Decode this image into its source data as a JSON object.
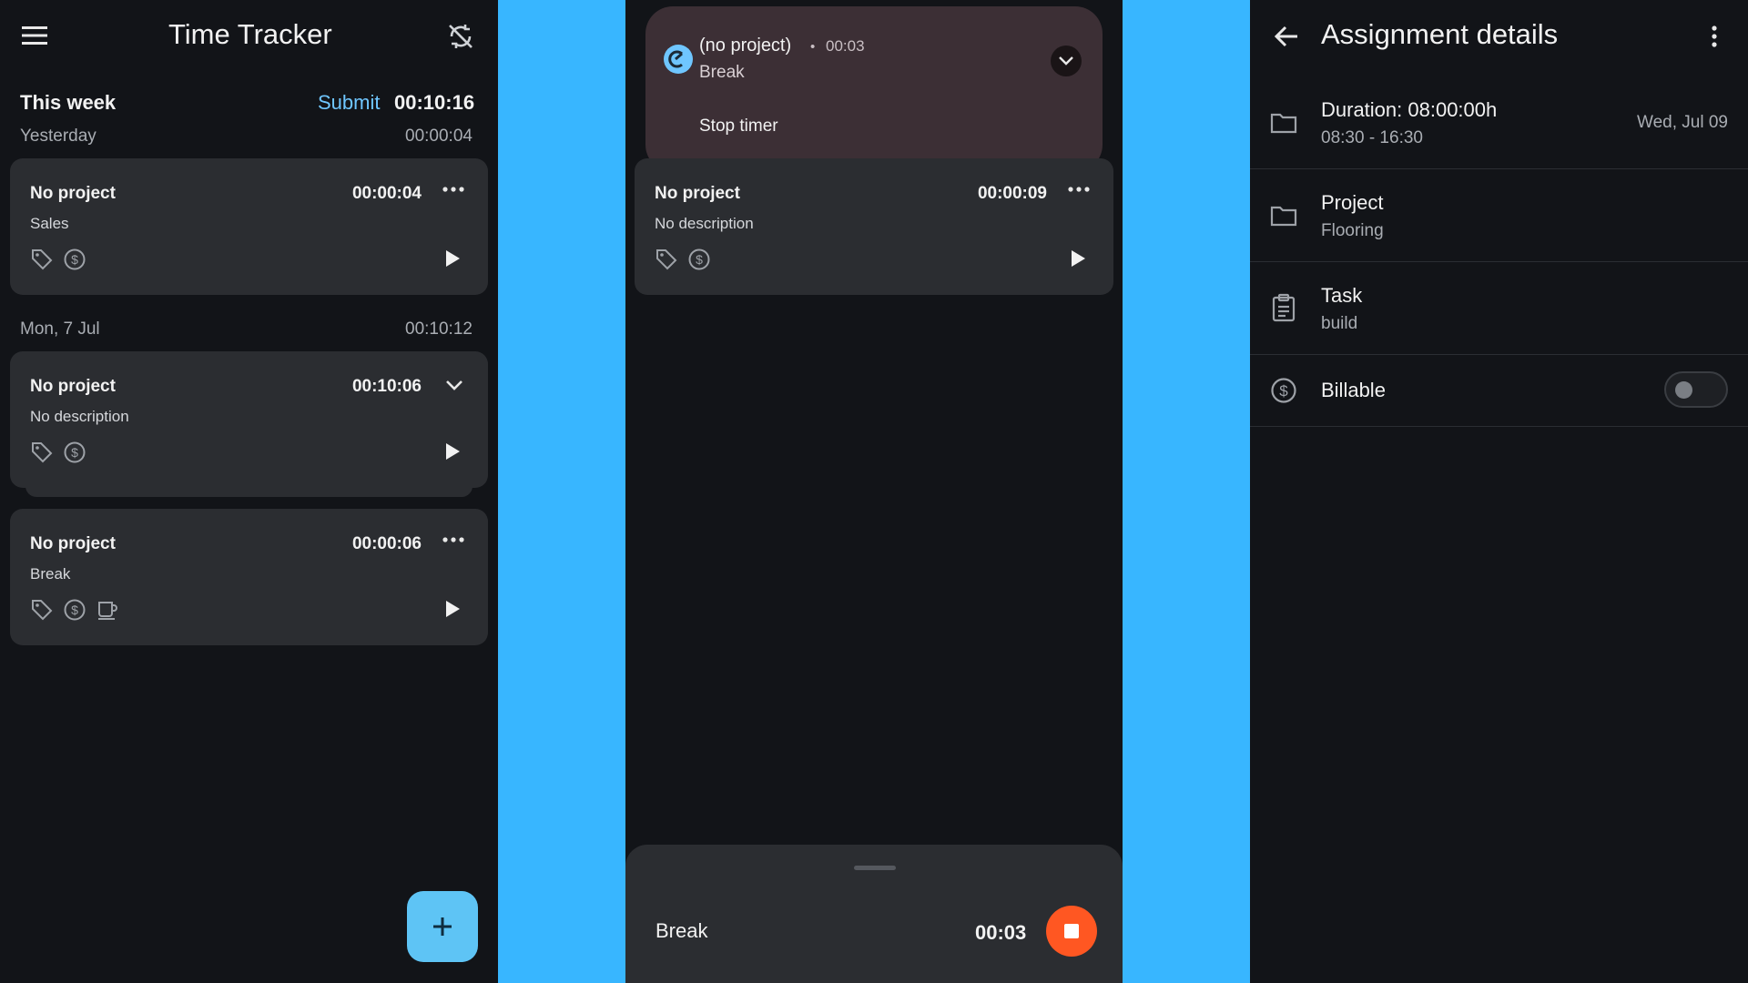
{
  "panel1": {
    "title": "Time Tracker",
    "week_label": "This week",
    "submit_label": "Submit",
    "week_total": "00:10:16",
    "groups": [
      {
        "day": "Yesterday",
        "total": "00:00:04",
        "entries": [
          {
            "project": "No project",
            "duration": "00:00:04",
            "description": "Sales"
          }
        ]
      },
      {
        "day": "Mon, 7 Jul",
        "total": "00:10:12",
        "entries": [
          {
            "project": "No project",
            "duration": "00:10:06",
            "description": "No description"
          },
          {
            "project": "No project",
            "duration": "00:00:06",
            "description": "Break"
          }
        ]
      }
    ],
    "fab_label": "+"
  },
  "panel2": {
    "notification": {
      "title": "(no project)",
      "separator": "•",
      "elapsed": "00:03",
      "subtitle": "Break",
      "action": "Stop timer"
    },
    "entry": {
      "project": "No project",
      "duration": "00:00:09",
      "description": "No description"
    },
    "sheet": {
      "label": "Break",
      "elapsed": "00:03"
    },
    "colors": {
      "stop": "#ff5722",
      "notif_bg": "#3c2f35"
    }
  },
  "panel3": {
    "title": "Assignment details",
    "duration_label": "Duration: 08:00:00h",
    "time_range": "08:30 - 16:30",
    "date": "Wed, Jul 09",
    "project_label": "Project",
    "project_value": "Flooring",
    "task_label": "Task",
    "task_value": "build",
    "billable_label": "Billable",
    "billable_on": false
  }
}
